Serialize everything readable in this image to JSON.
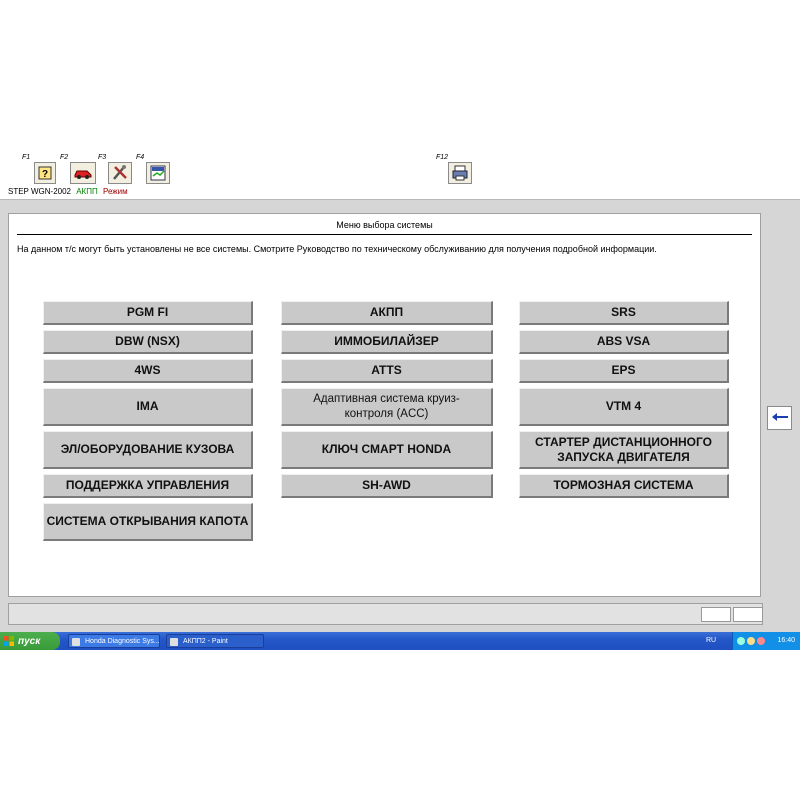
{
  "toolbar": {
    "keys": [
      {
        "label": "F1",
        "icon": "help-icon"
      },
      {
        "label": "F2",
        "icon": "car-icon"
      },
      {
        "label": "F3",
        "icon": "tools-icon"
      },
      {
        "label": "F4",
        "icon": "data-icon"
      },
      {
        "label": "F12",
        "icon": "printer-icon"
      }
    ]
  },
  "status": {
    "model": "STEP WGN-2002",
    "transmission": "АКПП",
    "mode": "Режим"
  },
  "panel": {
    "title": "Меню выбора системы",
    "info": "На данном т/с могут быть установлены не все системы. Смотрите Руководство по техническому обслуживанию для получения подробной информации."
  },
  "systems": {
    "col1": [
      "PGM FI",
      "DBW (NSX)",
      "4WS",
      "IMA",
      "ЭЛ/ОБОРУДОВАНИЕ КУЗОВА",
      "ПОДДЕРЖКА УПРАВЛЕНИЯ",
      "СИСТЕМА ОТКРЫВАНИЯ КАПОТА"
    ],
    "col2": [
      "АКПП",
      "ИММОБИЛАЙЗЕР",
      "ATTS",
      "Адаптивная система круиз-контроля (ACC)",
      "КЛЮЧ СМАРТ HONDA",
      "SH-AWD"
    ],
    "col3": [
      "SRS",
      "ABS VSA",
      "EPS",
      "VTM 4",
      "СТАРТЕР ДИСТАНЦИОННОГО ЗАПУСКА ДВИГАТЕЛЯ",
      "ТОРМОЗНАЯ СИСТЕМА"
    ]
  },
  "back_icon": "arrow-left-icon",
  "taskbar": {
    "start_label": "пуск",
    "tasks": [
      "Honda Diagnostic Sys...",
      "АКПП2 - Paint"
    ],
    "language": "RU",
    "clock": "16:40"
  },
  "colors": {
    "button_face": "#c9c9c9",
    "frame": "#d6d6d6",
    "taskbar": "#2457c8",
    "start_green": "#3a9a3a",
    "transmission_green": "#008000",
    "mode_red": "#a00000"
  }
}
